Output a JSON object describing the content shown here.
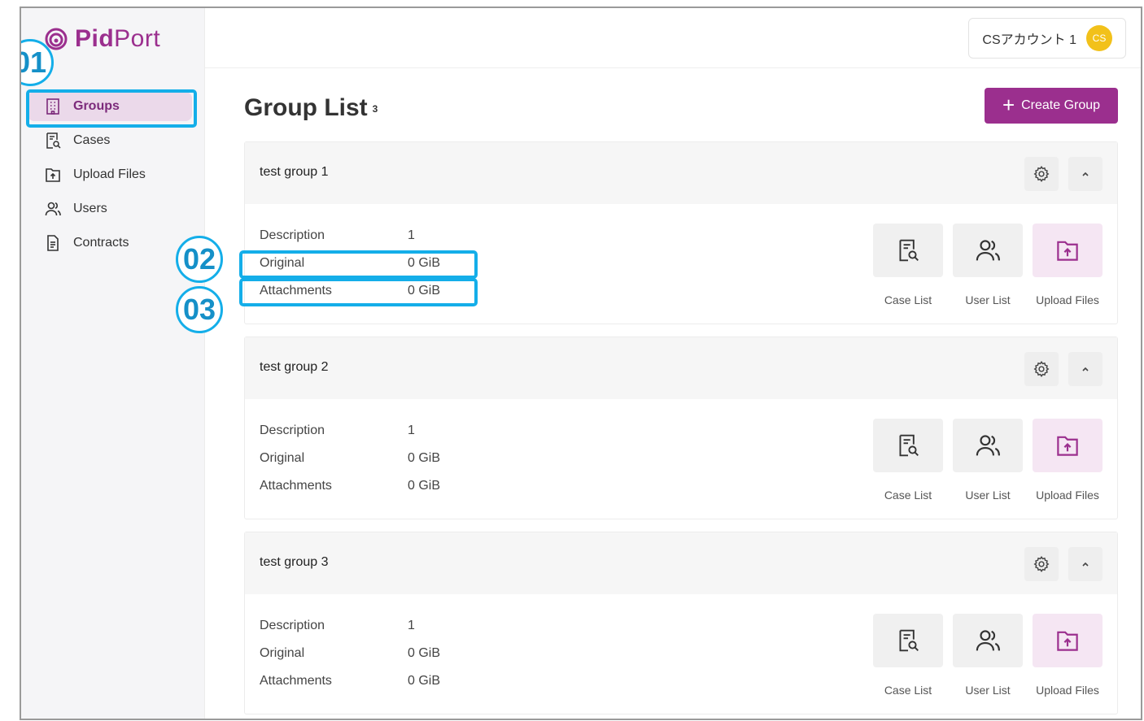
{
  "app": {
    "brand_prefix": "Pid",
    "brand_suffix": "Port"
  },
  "sidebar": {
    "items": [
      {
        "label": "Groups",
        "icon": "building-icon",
        "active": true
      },
      {
        "label": "Cases",
        "icon": "case-search-icon",
        "active": false
      },
      {
        "label": "Upload Files",
        "icon": "upload-icon",
        "active": false
      },
      {
        "label": "Users",
        "icon": "users-icon",
        "active": false
      },
      {
        "label": "Contracts",
        "icon": "document-icon",
        "active": false
      }
    ]
  },
  "header": {
    "account_name": "CSアカウント 1",
    "avatar_initials": "CS"
  },
  "page": {
    "title": "Group List",
    "count": "3",
    "create_button": "Create Group"
  },
  "groups": [
    {
      "name": "test group 1",
      "description_label": "Description",
      "description_value": "1",
      "original_label": "Original",
      "original_value": "0 GiB",
      "attachments_label": "Attachments",
      "attachments_value": "0 GiB"
    },
    {
      "name": "test group 2",
      "description_label": "Description",
      "description_value": "1",
      "original_label": "Original",
      "original_value": "0 GiB",
      "attachments_label": "Attachments",
      "attachments_value": "0 GiB"
    },
    {
      "name": "test group 3",
      "description_label": "Description",
      "description_value": "1",
      "original_label": "Original",
      "original_value": "0 GiB",
      "attachments_label": "Attachments",
      "attachments_value": "0 GiB"
    }
  ],
  "actions": {
    "case_list": "Case List",
    "user_list": "User List",
    "upload_files": "Upload Files"
  },
  "callouts": {
    "one": "01",
    "two": "02",
    "three": "03"
  },
  "colors": {
    "brand": "#9b2f8e",
    "highlight": "#14aee9",
    "avatar": "#f2c11a"
  }
}
